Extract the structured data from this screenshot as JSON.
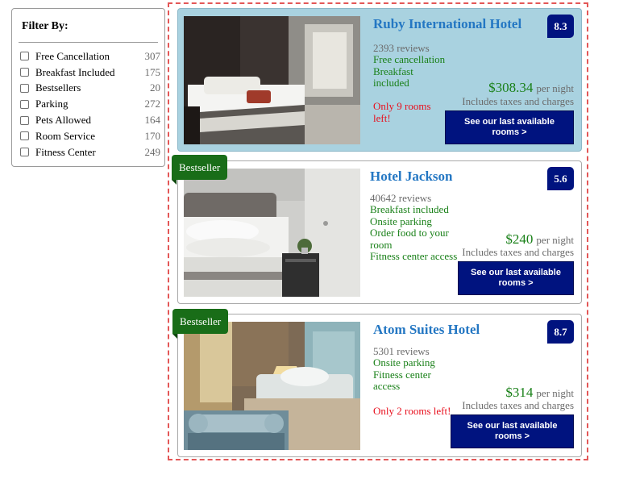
{
  "filter": {
    "title": "Filter By:",
    "items": [
      {
        "label": "Free Cancellation",
        "count": "307"
      },
      {
        "label": "Breakfast Included",
        "count": "175"
      },
      {
        "label": "Bestsellers",
        "count": "20"
      },
      {
        "label": "Parking",
        "count": "272"
      },
      {
        "label": "Pets Allowed",
        "count": "164"
      },
      {
        "label": "Room Service",
        "count": "170"
      },
      {
        "label": "Fitness Center",
        "count": "249"
      }
    ]
  },
  "hotels": [
    {
      "name": "Ruby International Hotel",
      "rating": "8.3",
      "reviews": "2393 reviews",
      "perks": [
        "Free cancellation",
        "Breakfast",
        "included"
      ],
      "scarcity": [
        "Only 9 rooms",
        "left!"
      ],
      "price": "$308.34",
      "per_night": "per night",
      "taxes": "Includes taxes and charges",
      "cta": [
        "See our last available",
        "rooms >"
      ],
      "badge": ""
    },
    {
      "name": "Hotel Jackson",
      "rating": "5.6",
      "reviews": "40642 reviews",
      "perks": [
        "Breakfast included",
        "Onsite parking",
        "Order food to your",
        "room",
        "Fitness center access"
      ],
      "scarcity": [],
      "price": "$240",
      "per_night": "per night",
      "taxes": "Includes taxes and charges",
      "cta": [
        "See our last available",
        "rooms >"
      ],
      "badge": "Bestseller"
    },
    {
      "name": "Atom Suites Hotel",
      "rating": "8.7",
      "reviews": "5301 reviews",
      "perks": [
        "Onsite parking",
        "Fitness center",
        "access"
      ],
      "scarcity": [
        "Only 2 rooms left!"
      ],
      "price": "$314",
      "per_night": "per night",
      "taxes": "Includes taxes and charges",
      "cta": [
        "See our last available",
        "rooms >"
      ],
      "badge": "Bestseller"
    }
  ],
  "colors": {
    "accent_blue": "#00137f",
    "link_blue": "#2477c3",
    "perk_green": "#198018",
    "badge_green": "#196d18",
    "scarcity_red": "#e8101e",
    "highlight_card": "#a9d2e0",
    "selection_outline": "#e35757"
  }
}
